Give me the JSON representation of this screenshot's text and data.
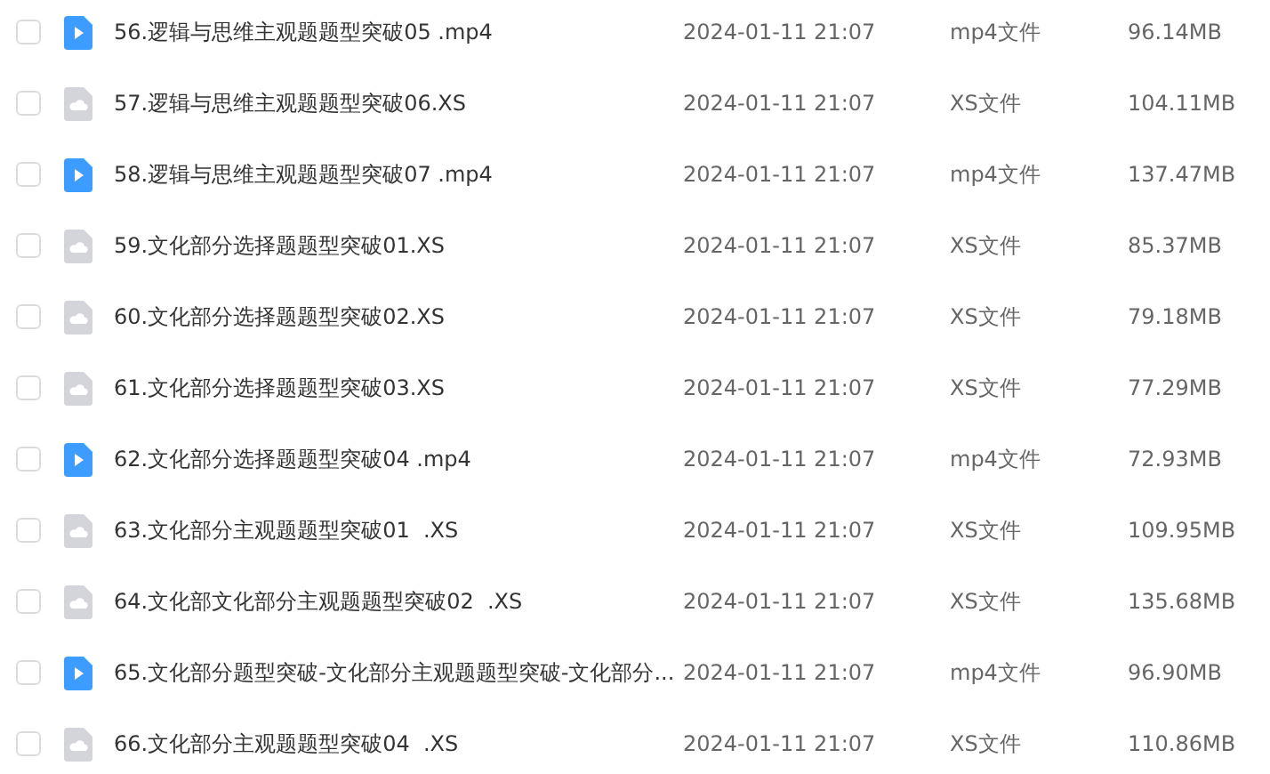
{
  "files": [
    {
      "kind": "video",
      "checked": false,
      "name": "56.逻辑与思维主观题题型突破05 .mp4",
      "modified": "2024-01-11 21:07",
      "type": "mp4文件",
      "size": "96.14MB"
    },
    {
      "kind": "cloud",
      "checked": false,
      "name": "57.逻辑与思维主观题题型突破06.XS",
      "modified": "2024-01-11 21:07",
      "type": "XS文件",
      "size": "104.11MB"
    },
    {
      "kind": "video",
      "checked": false,
      "name": "58.逻辑与思维主观题题型突破07 .mp4",
      "modified": "2024-01-11 21:07",
      "type": "mp4文件",
      "size": "137.47MB"
    },
    {
      "kind": "cloud",
      "checked": false,
      "name": "59.文化部分选择题题型突破01.XS",
      "modified": "2024-01-11 21:07",
      "type": "XS文件",
      "size": "85.37MB"
    },
    {
      "kind": "cloud",
      "checked": false,
      "name": "60.文化部分选择题题型突破02.XS",
      "modified": "2024-01-11 21:07",
      "type": "XS文件",
      "size": "79.18MB"
    },
    {
      "kind": "cloud",
      "checked": false,
      "name": "61.文化部分选择题题型突破03.XS",
      "modified": "2024-01-11 21:07",
      "type": "XS文件",
      "size": "77.29MB"
    },
    {
      "kind": "video",
      "checked": false,
      "name": "62.文化部分选择题题型突破04 .mp4",
      "modified": "2024-01-11 21:07",
      "type": "mp4文件",
      "size": "72.93MB"
    },
    {
      "kind": "cloud",
      "checked": false,
      "name": "63.文化部分主观题题型突破01  .XS",
      "modified": "2024-01-11 21:07",
      "type": "XS文件",
      "size": "109.95MB"
    },
    {
      "kind": "cloud",
      "checked": false,
      "name": "64.文化部文化部分主观题题型突破02  .XS",
      "modified": "2024-01-11 21:07",
      "type": "XS文件",
      "size": "135.68MB"
    },
    {
      "kind": "video",
      "checked": false,
      "name": "65.文化部分题型突破-文化部分主观题题型突破-文化部分...",
      "modified": "2024-01-11 21:07",
      "type": "mp4文件",
      "size": "96.90MB"
    },
    {
      "kind": "cloud",
      "checked": false,
      "name": "66.文化部分主观题题型突破04  .XS",
      "modified": "2024-01-11 21:07",
      "type": "XS文件",
      "size": "110.86MB"
    }
  ]
}
